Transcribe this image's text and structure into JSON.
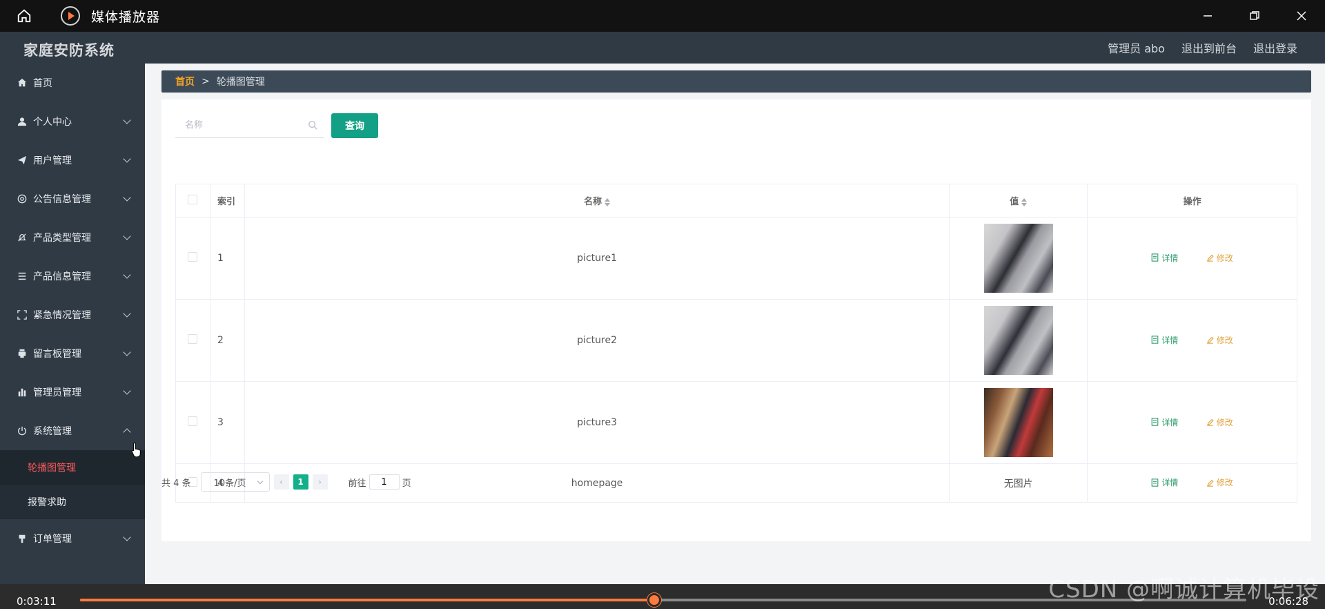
{
  "player": {
    "title": "媒体播放器",
    "time_elapsed": "0:03:11",
    "time_total": "0:06:28",
    "progress": 0.4925,
    "accent_color": "#ff7a3d"
  },
  "header": {
    "brand": "家庭安防系统",
    "user": "管理员 abo",
    "back_front": "退出到前台",
    "logout": "退出登录"
  },
  "sidebar": {
    "items": [
      {
        "label": "首页",
        "icon": "home-icon"
      },
      {
        "label": "个人中心",
        "icon": "user-icon"
      },
      {
        "label": "用户管理",
        "icon": "paper-plane-icon"
      },
      {
        "label": "公告信息管理",
        "icon": "settings-circle-icon"
      },
      {
        "label": "产品类型管理",
        "icon": "bell-off-icon"
      },
      {
        "label": "产品信息管理",
        "icon": "list-icon"
      },
      {
        "label": "紧急情况管理",
        "icon": "fullscreen-icon"
      },
      {
        "label": "留言板管理",
        "icon": "printer-icon"
      },
      {
        "label": "管理员管理",
        "icon": "bar-chart-icon"
      },
      {
        "label": "系统管理",
        "icon": "power-icon"
      },
      {
        "label": "订单管理",
        "icon": "pin-icon"
      }
    ],
    "sub_items": [
      {
        "label": "轮播图管理"
      },
      {
        "label": "报警求助"
      }
    ]
  },
  "breadcrumb": {
    "home": "首页",
    "separator": ">",
    "current": "轮播图管理"
  },
  "search": {
    "placeholder": "名称",
    "button": "查询"
  },
  "table": {
    "headers": {
      "index": "索引",
      "name": "名称",
      "value": "值",
      "actions": "操作"
    },
    "rows": [
      {
        "index": "1",
        "name": "picture1",
        "value": ""
      },
      {
        "index": "2",
        "name": "picture2",
        "value": ""
      },
      {
        "index": "3",
        "name": "picture3",
        "value": ""
      },
      {
        "index": "4",
        "name": "homepage",
        "value": "无图片"
      }
    ],
    "action_detail": "详情",
    "action_edit": "修改"
  },
  "pagination": {
    "total": "共 4 条",
    "page_size": "10条/页",
    "current_page": "1",
    "goto_label": "前往",
    "goto_value": "1",
    "page_unit": "页"
  },
  "watermark": "CSDN @啊诚计算机毕设"
}
